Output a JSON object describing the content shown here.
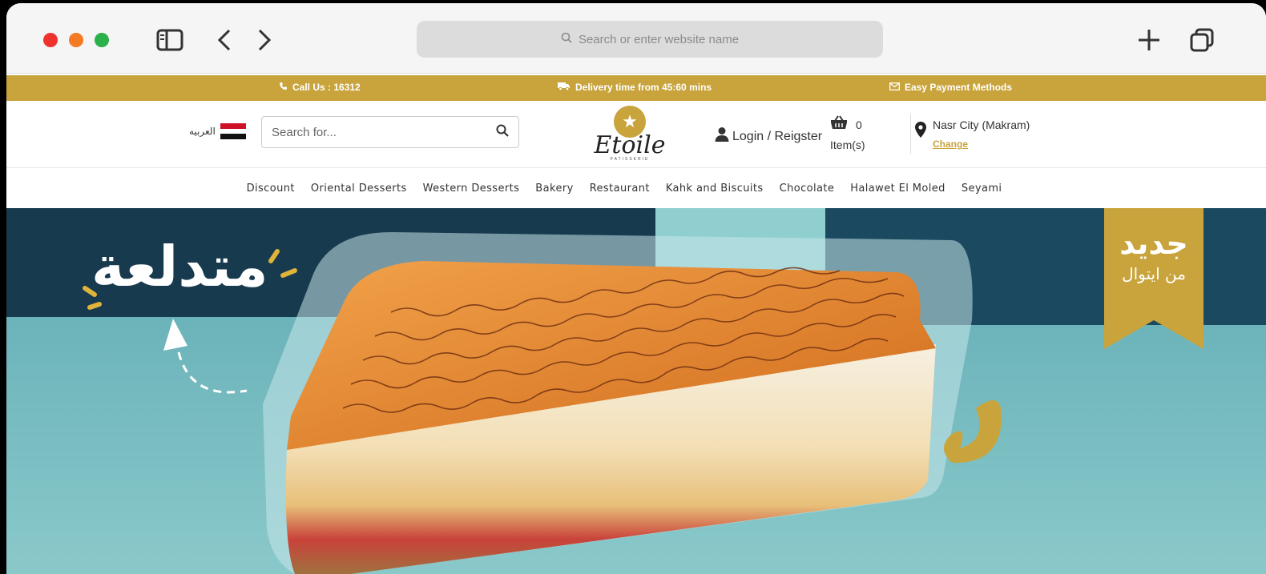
{
  "browser": {
    "address_placeholder": "Search or enter website name"
  },
  "infobar": {
    "call": "Call Us : 16312",
    "delivery": "Delivery time from 45:60 mins",
    "payment": "Easy Payment Methods"
  },
  "header": {
    "language": "العربيه",
    "search_placeholder": "Search for...",
    "logo_text": "Etoile",
    "logo_sub": "PATISSERIE",
    "login": "Login / Reigster",
    "cart_count": "0",
    "cart_items": "Item(s)",
    "location": "Nasr City (Makram)",
    "change": "Change"
  },
  "nav": {
    "items": [
      "Discount",
      "Oriental Desserts",
      "Western Desserts",
      "Bakery",
      "Restaurant",
      "Kahk and Biscuits",
      "Chocolate",
      "Halawet El Moled",
      "Seyami"
    ]
  },
  "hero": {
    "headline": "متدلعة",
    "badge_main": "جديد",
    "badge_sub": "من ايتوال"
  },
  "colors": {
    "gold": "#c9a43c",
    "dark_teal": "#173a4e",
    "light_teal": "#7ec3c7"
  }
}
